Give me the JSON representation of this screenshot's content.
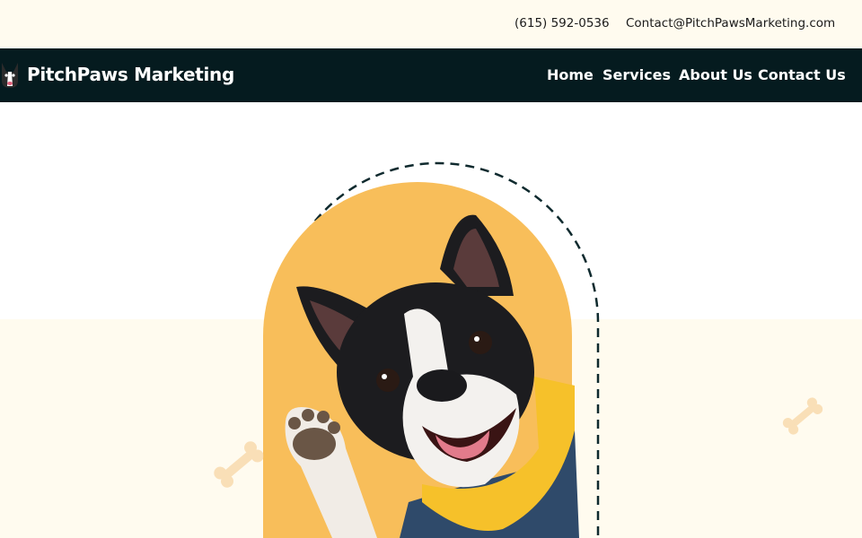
{
  "topbar": {
    "phone": "(615) 592-0536",
    "email": "Contact@PitchPawsMarketing.com"
  },
  "navbar": {
    "brand": "PitchPaws Marketing",
    "logo_icon": "boston-terrier-logo-icon",
    "items": [
      {
        "label": "Home"
      },
      {
        "label": "Services"
      },
      {
        "label": "About Us"
      },
      {
        "label": "Contact Us"
      }
    ]
  },
  "hero": {
    "image": "boston-terrier-waving-photo",
    "decorations": [
      "bone-icon",
      "bone-icon"
    ],
    "colors": {
      "arch": "#f8be5a",
      "dashed_ring": "#0f2a2e",
      "nav_bg": "#051b1f",
      "cream": "#fffbef"
    }
  }
}
